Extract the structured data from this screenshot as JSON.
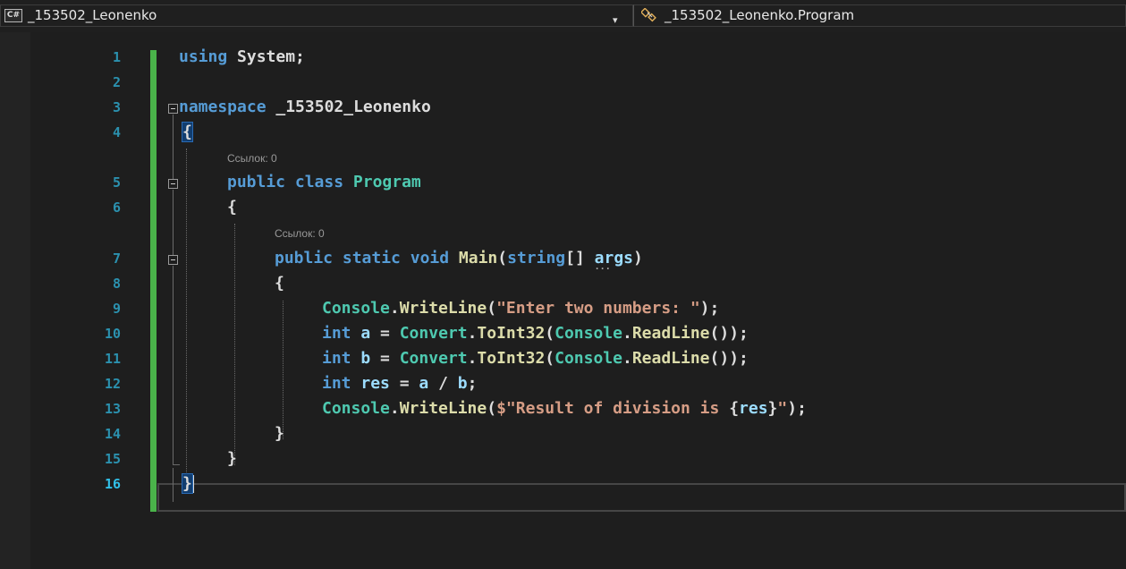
{
  "navbar": {
    "language_badge": "C#",
    "project": "_153502_Leonenko",
    "type": "_153502_Leonenko.Program",
    "dropdown_caret": "▾"
  },
  "editor": {
    "line_numbers": [
      "1",
      "2",
      "3",
      "4",
      "5",
      "6",
      "7",
      "8",
      "9",
      "10",
      "11",
      "12",
      "13",
      "14",
      "15",
      "16"
    ],
    "codelens": [
      "Ссылок: 0",
      "Ссылок: 0"
    ],
    "tokens": {
      "l1_using": "using",
      "l1_system": " System;",
      "l3_namespace": "namespace",
      "l3_name": " _153502_Leonenko",
      "l4_brace": "{",
      "l5_public": "public",
      "l5_class": " class",
      "l5_program": " Program",
      "l6_brace": "{",
      "l7_public": "public",
      "l7_static": " static",
      "l7_void": " void",
      "l7_main": " Main",
      "l7_open": "(",
      "l7_string": "string",
      "l7_arr": "[] ",
      "l7_args": "args",
      "l7_close": ")",
      "l8_brace": "{",
      "l9_console": "Console",
      "l9_dot": ".",
      "l9_wl": "WriteLine",
      "l9_open": "(",
      "l9_str": "\"Enter two numbers: \"",
      "l9_close": ");",
      "l10_int": "int",
      "l10_a": " a",
      "l10_eq": " = ",
      "l10_convert": "Convert",
      "l10_dot": ".",
      "l10_toint": "ToInt32",
      "l10_open": "(",
      "l10_console": "Console",
      "l10_dot2": ".",
      "l10_rl": "ReadLine",
      "l10_close": "());",
      "l11_int": "int",
      "l11_b": " b",
      "l11_eq": " = ",
      "l11_convert": "Convert",
      "l11_dot": ".",
      "l11_toint": "ToInt32",
      "l11_open": "(",
      "l11_console": "Console",
      "l11_dot2": ".",
      "l11_rl": "ReadLine",
      "l11_close": "());",
      "l12_int": "int",
      "l12_res": " res",
      "l12_eq": " = ",
      "l12_a": "a",
      "l12_div": " / ",
      "l12_b": "b",
      "l12_semi": ";",
      "l13_console": "Console",
      "l13_dot": ".",
      "l13_wl": "WriteLine",
      "l13_open": "(",
      "l13_str1": "$\"Result of division is ",
      "l13_lb": "{",
      "l13_res": "res",
      "l13_rb": "}",
      "l13_str2": "\"",
      "l13_close": ");",
      "l14_brace": "}",
      "l15_brace": "}",
      "l16_brace": "}"
    }
  },
  "colors": {
    "background": "#1e1e1e",
    "keyword": "#569cd6",
    "type": "#4ec9b0",
    "method": "#dcdcaa",
    "string": "#d69d85",
    "variable": "#9cdcfe",
    "line_number": "#2b91af",
    "change_bar": "#4ab34a"
  }
}
